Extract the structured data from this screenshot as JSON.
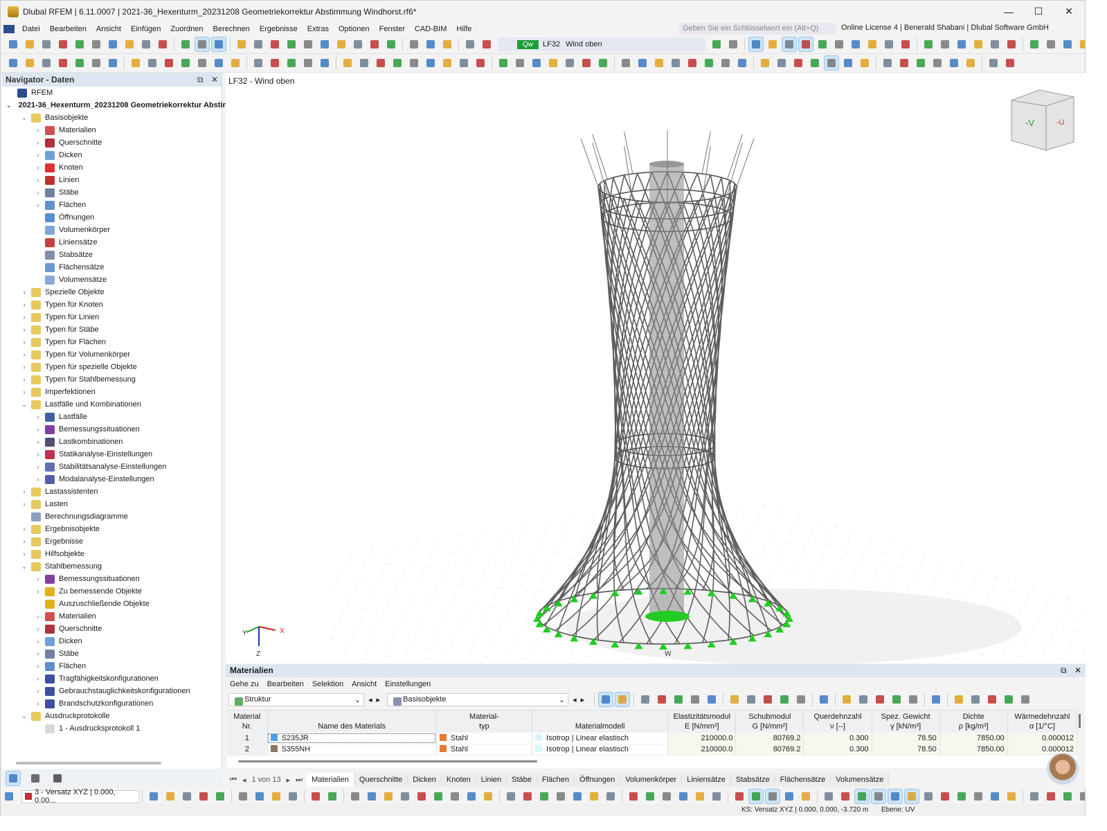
{
  "title": "Dlubal RFEM | 6.11.0007 | 2021-36_Hexenturm_20231208 Geometriekorrektur Abstimmung Windhorst.rf6*",
  "window_controls": {
    "minimize": "—",
    "maximize": "☐",
    "close": "✕"
  },
  "menu": [
    "Datei",
    "Bearbeiten",
    "Ansicht",
    "Einfügen",
    "Zuordnen",
    "Berechnen",
    "Ergebnisse",
    "Extras",
    "Optionen",
    "Fenster",
    "CAD-BIM",
    "Hilfe"
  ],
  "search_placeholder": "Geben Sie ein Schlüsselwort ein (Alt+Q)",
  "license": "Online License 4 | Benerald Shabani | Dlubal Software GmbH",
  "loadcase": {
    "badge": "Qw",
    "id": "LF32",
    "name": "Wind oben"
  },
  "navigator": {
    "title": "Navigator - Daten",
    "items": [
      {
        "l": 0,
        "t": "RFEM",
        "a": "",
        "c": "#2a4d8f"
      },
      {
        "l": 0,
        "t": "2021-36_Hexenturm_20231208 Geometriekorrektur Abstir",
        "a": "v",
        "c": "#6a7d99",
        "b": true
      },
      {
        "l": 1,
        "t": "Basisobjekte",
        "a": "v",
        "c": "#e8c860"
      },
      {
        "l": 2,
        "t": "Materialien",
        "a": ">",
        "c": "#d05050"
      },
      {
        "l": 2,
        "t": "Querschnitte",
        "a": ">",
        "c": "#b03040"
      },
      {
        "l": 2,
        "t": "Dicken",
        "a": ">",
        "c": "#6fa0d8"
      },
      {
        "l": 2,
        "t": "Knoten",
        "a": ">",
        "c": "#e03030"
      },
      {
        "l": 2,
        "t": "Linien",
        "a": ">",
        "c": "#c03030"
      },
      {
        "l": 2,
        "t": "Stäbe",
        "a": ">",
        "c": "#7080a0"
      },
      {
        "l": 2,
        "t": "Flächen",
        "a": ">",
        "c": "#6090c8"
      },
      {
        "l": 2,
        "t": "Öffnungen",
        "a": "",
        "c": "#5a8ed0"
      },
      {
        "l": 2,
        "t": "Volumenkörper",
        "a": "",
        "c": "#7fa6d8"
      },
      {
        "l": 2,
        "t": "Liniensätze",
        "a": "",
        "c": "#c84040"
      },
      {
        "l": 2,
        "t": "Stabsätze",
        "a": "",
        "c": "#8090a8"
      },
      {
        "l": 2,
        "t": "Flächensätze",
        "a": "",
        "c": "#6a9ad0"
      },
      {
        "l": 2,
        "t": "Volumensätze",
        "a": "",
        "c": "#8aa8d8"
      },
      {
        "l": 1,
        "t": "Spezielle Objekte",
        "a": ">",
        "c": "#e8c860"
      },
      {
        "l": 1,
        "t": "Typen für Knoten",
        "a": ">",
        "c": "#e8c860"
      },
      {
        "l": 1,
        "t": "Typen für Linien",
        "a": ">",
        "c": "#e8c860"
      },
      {
        "l": 1,
        "t": "Typen für Stäbe",
        "a": ">",
        "c": "#e8c860"
      },
      {
        "l": 1,
        "t": "Typen für Flächen",
        "a": ">",
        "c": "#e8c860"
      },
      {
        "l": 1,
        "t": "Typen für Volumenkörper",
        "a": ">",
        "c": "#e8c860"
      },
      {
        "l": 1,
        "t": "Typen für spezielle Objekte",
        "a": ">",
        "c": "#e8c860"
      },
      {
        "l": 1,
        "t": "Typen für Stahlbemessung",
        "a": ">",
        "c": "#e8c860"
      },
      {
        "l": 1,
        "t": "Imperfektionen",
        "a": ">",
        "c": "#e8c860"
      },
      {
        "l": 1,
        "t": "Lastfälle und Kombinationen",
        "a": "v",
        "c": "#e8c860"
      },
      {
        "l": 2,
        "t": "Lastfälle",
        "a": ">",
        "c": "#4060a0"
      },
      {
        "l": 2,
        "t": "Bemessungssituationen",
        "a": ">",
        "c": "#8040a0"
      },
      {
        "l": 2,
        "t": "Lastkombinationen",
        "a": ">",
        "c": "#505070"
      },
      {
        "l": 2,
        "t": "Statikanalyse-Einstellungen",
        "a": ">",
        "c": "#c03050"
      },
      {
        "l": 2,
        "t": "Stabilitätsanalyse-Einstellungen",
        "a": ">",
        "c": "#6070b0"
      },
      {
        "l": 2,
        "t": "Modalanalyse-Einstellungen",
        "a": ">",
        "c": "#5060a8"
      },
      {
        "l": 1,
        "t": "Lastassistenten",
        "a": ">",
        "c": "#e8c860"
      },
      {
        "l": 1,
        "t": "Lasten",
        "a": ">",
        "c": "#e8c860"
      },
      {
        "l": 1,
        "t": "Berechnungsdiagramme",
        "a": "",
        "c": "#8aa0c0"
      },
      {
        "l": 1,
        "t": "Ergebnisobjekte",
        "a": ">",
        "c": "#e8c860"
      },
      {
        "l": 1,
        "t": "Ergebnisse",
        "a": ">",
        "c": "#e8c860"
      },
      {
        "l": 1,
        "t": "Hilfsobjekte",
        "a": ">",
        "c": "#e8c860"
      },
      {
        "l": 1,
        "t": "Stahlbemessung",
        "a": "v",
        "c": "#e8c860"
      },
      {
        "l": 2,
        "t": "Bemessungssituationen",
        "a": ">",
        "c": "#8040a0"
      },
      {
        "l": 2,
        "t": "Zu bemessende Objekte",
        "a": ">",
        "c": "#e0b020"
      },
      {
        "l": 2,
        "t": "Auszuschließende Objekte",
        "a": "",
        "c": "#e0b020"
      },
      {
        "l": 2,
        "t": "Materialien",
        "a": ">",
        "c": "#d05050"
      },
      {
        "l": 2,
        "t": "Querschnitte",
        "a": ">",
        "c": "#b03040"
      },
      {
        "l": 2,
        "t": "Dicken",
        "a": ">",
        "c": "#6fa0d8"
      },
      {
        "l": 2,
        "t": "Stäbe",
        "a": ">",
        "c": "#7080a0"
      },
      {
        "l": 2,
        "t": "Flächen",
        "a": ">",
        "c": "#6090c8"
      },
      {
        "l": 2,
        "t": "Tragfähigkeitskonfigurationen",
        "a": ">",
        "c": "#4050a0"
      },
      {
        "l": 2,
        "t": "Gebrauchstauglichkeitskonfigurationen",
        "a": ">",
        "c": "#4050a0"
      },
      {
        "l": 2,
        "t": "Brandschutzkonfigurationen",
        "a": ">",
        "c": "#4050a0"
      },
      {
        "l": 1,
        "t": "Ausdruckprotokolle",
        "a": "v",
        "c": "#e8c860"
      },
      {
        "l": 2,
        "t": "1 - Ausdrucksprotokoll 1",
        "a": "",
        "c": "#d8d8d8"
      }
    ]
  },
  "viewport": {
    "title": "LF32 - Wind oben",
    "cube_label": "-V",
    "axes": {
      "x": "X",
      "y": "Y",
      "z": "Z",
      "w": "W"
    }
  },
  "panel": {
    "title": "Materialien",
    "menu": [
      "Gehe zu",
      "Bearbeiten",
      "Selektion",
      "Ansicht",
      "Einstellungen"
    ],
    "filter1": "Struktur",
    "filter2": "Basisobjekte",
    "columns": [
      [
        "Material",
        "Nr."
      ],
      [
        "",
        "Name des Materials"
      ],
      [
        "Material-",
        "typ"
      ],
      [
        "",
        "Materialmodell"
      ],
      [
        "Elastizitätsmodul",
        "E [N/mm²]"
      ],
      [
        "Schubmodul",
        "G [N/mm²]"
      ],
      [
        "Querdehnzahl",
        "ν [--]"
      ],
      [
        "Spez. Gewicht",
        "γ [kN/m³]"
      ],
      [
        "Dichte",
        "ρ [kg/m³]"
      ],
      [
        "Wärmedehnzahl",
        "α [1/°C]"
      ]
    ],
    "rows": [
      {
        "nr": "1",
        "name": "S235JR",
        "name_color": "#4aa0f0",
        "typ": "Stahl",
        "typ_color": "#e87830",
        "model": "Isotrop | Linear elastisch",
        "E": "210000.0",
        "G": "80769.2",
        "nu": "0.300",
        "gamma": "78.50",
        "rho": "7850.00",
        "alpha": "0.000012"
      },
      {
        "nr": "2",
        "name": "S355NH",
        "name_color": "#8a7560",
        "typ": "Stahl",
        "typ_color": "#e87830",
        "model": "Isotrop | Linear elastisch",
        "E": "210000.0",
        "G": "80769.2",
        "nu": "0.300",
        "gamma": "78.50",
        "rho": "7850.00",
        "alpha": "0.000012"
      }
    ],
    "pager": "1 von 13",
    "tabs": [
      "Materialien",
      "Querschnitte",
      "Dicken",
      "Knoten",
      "Linien",
      "Stäbe",
      "Flächen",
      "Öffnungen",
      "Volumenkörper",
      "Liniensätze",
      "Stabsätze",
      "Flächensätze",
      "Volumensätze"
    ],
    "active_tab": 0
  },
  "bottom": {
    "coord_system": "3 - Versatz XYZ | 0.000, 0.00..."
  },
  "status": {
    "ks": "KS: Versatz XYZ | 0.000, 0.000, -3.720 m",
    "ebene": "Ebene: UV"
  }
}
